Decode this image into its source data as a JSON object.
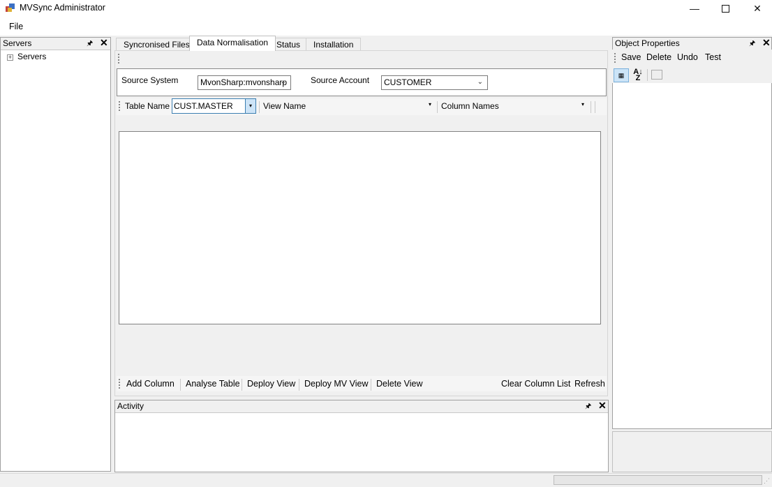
{
  "window": {
    "title": "MVSync Administrator",
    "minimize_glyph": "—",
    "close_glyph": "✕"
  },
  "menu": {
    "file": "File"
  },
  "servers_panel": {
    "title": "Servers",
    "pin_glyph": "🖈",
    "close_glyph": "✕",
    "tree_root": "Servers",
    "expander_glyph": "+"
  },
  "tabs": [
    {
      "label": "Syncronised Files",
      "active": false
    },
    {
      "label": "Data Normalisation",
      "active": true
    },
    {
      "label": "Status",
      "active": false
    },
    {
      "label": "Installation",
      "active": false
    }
  ],
  "source": {
    "system_label": "Source System",
    "system_value": "MvonSharp:mvonsharp",
    "account_label": "Source Account",
    "account_value": "CUSTOMER",
    "chevron_glyph": "⌄"
  },
  "table_toolbar": {
    "table_name_label": "Table Name",
    "table_name_value": "CUST.MASTER",
    "view_name_label": "View Name",
    "view_name_value": "",
    "column_names_label": "Column Names",
    "column_names_value": "",
    "dropdown_glyph": "▾"
  },
  "actions": {
    "add_column": "Add Column",
    "analyse_table": "Analyse Table",
    "deploy_view": "Deploy View",
    "deploy_mv_view": "Deploy MV View",
    "delete_view": "Delete View",
    "clear_column_list": "Clear Column List",
    "refresh": "Refresh"
  },
  "activity_panel": {
    "title": "Activity",
    "pin_glyph": "🖈",
    "close_glyph": "✕"
  },
  "properties_panel": {
    "title": "Object Properties",
    "pin_glyph": "🖈",
    "close_glyph": "✕",
    "save": "Save",
    "delete": "Delete",
    "undo": "Undo",
    "test": "Test",
    "categorized_glyph": "▦",
    "alphabetical_glyph": "A↓",
    "alphabetical_glyph2": "Z"
  },
  "statusbar": {
    "grip_glyph": "⋰"
  },
  "colors": {
    "accent_focus": "#3c7fb1",
    "toolbar_selected": "#cce4f7"
  }
}
